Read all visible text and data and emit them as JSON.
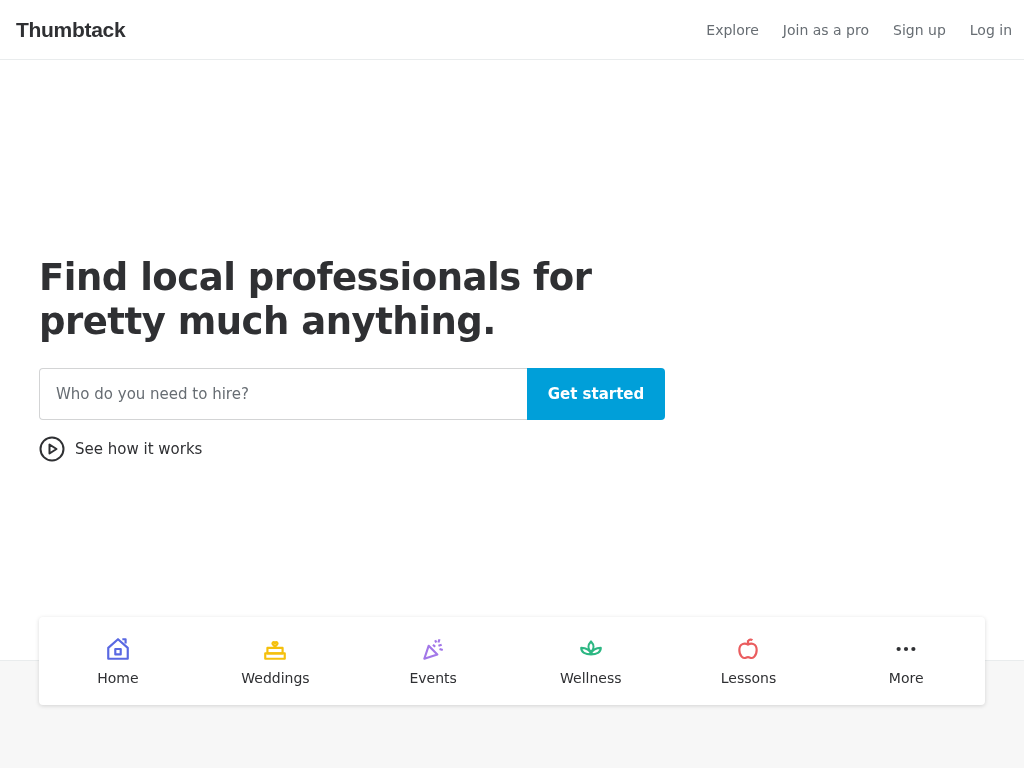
{
  "header": {
    "logo": "Thumbtack",
    "nav": [
      "Explore",
      "Join as a pro",
      "Sign up",
      "Log in"
    ]
  },
  "hero": {
    "title": "Find local professionals for pretty much anything.",
    "search": {
      "placeholder": "Who do you need to hire?"
    },
    "button": "Get started",
    "video_link": "See how it works"
  },
  "categories": [
    {
      "kind": "home",
      "label": "Home",
      "color": "#5968e2"
    },
    {
      "kind": "weddings",
      "label": "Weddings",
      "color": "#f5c00c"
    },
    {
      "kind": "events",
      "label": "Events",
      "color": "#a277e8"
    },
    {
      "kind": "wellness",
      "label": "Wellness",
      "color": "#2db783"
    },
    {
      "kind": "lessons",
      "label": "Lessons",
      "color": "#ea5d5f"
    },
    {
      "kind": "more",
      "label": "More",
      "color": "#2f3033"
    }
  ]
}
